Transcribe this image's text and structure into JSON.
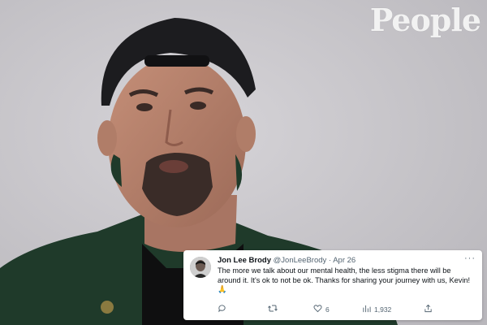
{
  "watermark": {
    "brand": "People"
  },
  "tweet": {
    "author_name": "Jon Lee Brody",
    "handle": "@JonLeeBrody",
    "separator": "·",
    "date": "Apr 26",
    "text": "The more we talk about our mental health, the less stigma there will be around it. It's ok to not be ok. Thanks for sharing your journey with us, Kevin! 🙏",
    "more_label": "···",
    "actions": {
      "reply_icon": "reply-icon",
      "retweet_icon": "retweet-icon",
      "like_icon": "heart-icon",
      "like_count": "6",
      "views_icon": "views-icon",
      "views_count": "1,932",
      "share_icon": "share-icon"
    }
  },
  "colors": {
    "background": "#c9c7cc",
    "tweet_text": "#0f1419",
    "tweet_meta": "#536471",
    "jacket": "#1f3a2a",
    "cap": "#1c1c1f"
  }
}
